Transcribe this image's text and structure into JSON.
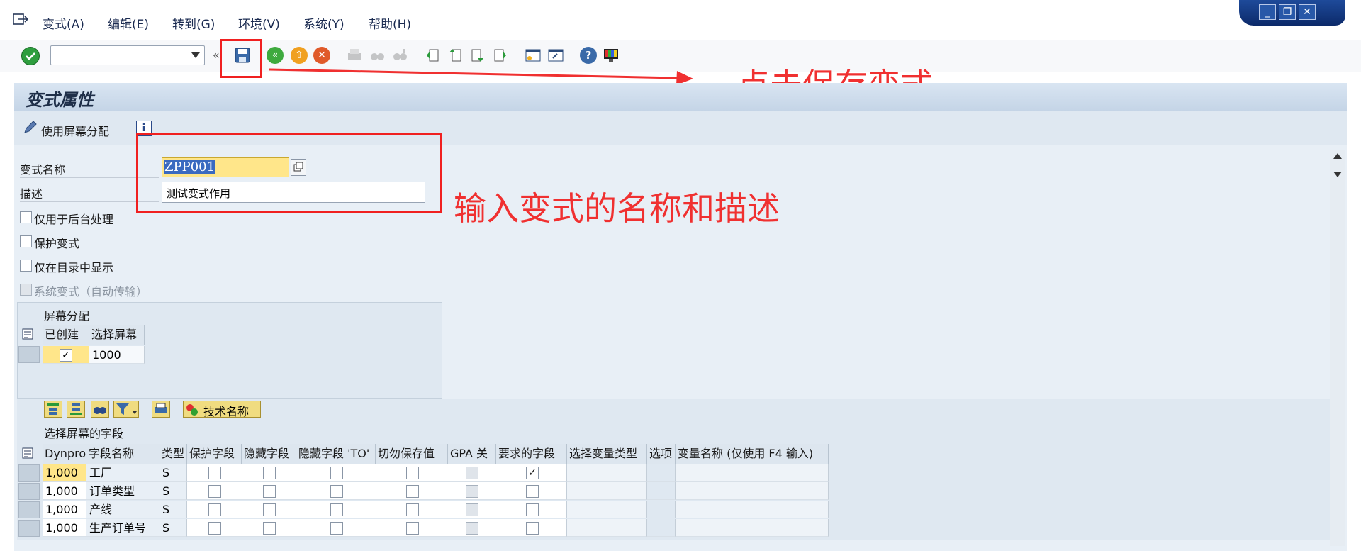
{
  "menu": {
    "items": [
      {
        "label": "变式(A)"
      },
      {
        "label": "编辑(E)"
      },
      {
        "label": "转到(G)"
      },
      {
        "label": "环境(V)"
      },
      {
        "label": "系统(Y)"
      },
      {
        "label": "帮助(H)"
      }
    ]
  },
  "window_controls": {
    "minimize": "_",
    "restore": "❐",
    "close": "✕"
  },
  "command_field": {
    "value": ""
  },
  "page": {
    "title": "变式属性"
  },
  "app_toolbar": {
    "screen_assign_label": "使用屏幕分配",
    "info_label": "i"
  },
  "form": {
    "variant_name_label": "变式名称",
    "variant_name_value": "ZPP001",
    "description_label": "描述",
    "description_value": "测试变式作用",
    "checkbox_background": "仅用于后台处理",
    "checkbox_protect": "保护变式",
    "checkbox_catalog": "仅在目录中显示",
    "checkbox_system": "系统变式（自动传输）"
  },
  "screen_assign": {
    "section_title": "屏幕分配",
    "headers": [
      "已创建",
      "选择屏幕"
    ],
    "rows": [
      {
        "created": "✓",
        "screen": "1000"
      }
    ]
  },
  "fields_toolbar": {
    "tech_name_label": "技术名称"
  },
  "fields_table": {
    "section_title": "选择屏幕的字段",
    "headers": [
      "Dynpro",
      "字段名称",
      "类型",
      "保护字段",
      "隐藏字段",
      "隐藏字段 'TO'",
      "切勿保存值",
      "GPA 关",
      "要求的字段",
      "选择变量类型",
      "选项",
      "变量名称 (仅使用 F4 输入)"
    ],
    "rows": [
      {
        "dynpro": "1,000",
        "name": "工厂",
        "type": "S",
        "required": "✓"
      },
      {
        "dynpro": "1,000",
        "name": "订单类型",
        "type": "S",
        "required": ""
      },
      {
        "dynpro": "1,000",
        "name": "产线",
        "type": "S",
        "required": ""
      },
      {
        "dynpro": "1,000",
        "name": "生产订单号",
        "type": "S",
        "required": ""
      }
    ]
  },
  "annotations": {
    "save_note": "点击保存变式",
    "input_note": "输入变式的名称和描述"
  },
  "colors": {
    "accent_red": "#f03030",
    "title_bg": "#c4d4e6",
    "highlight_yellow": "#ffe68a"
  }
}
